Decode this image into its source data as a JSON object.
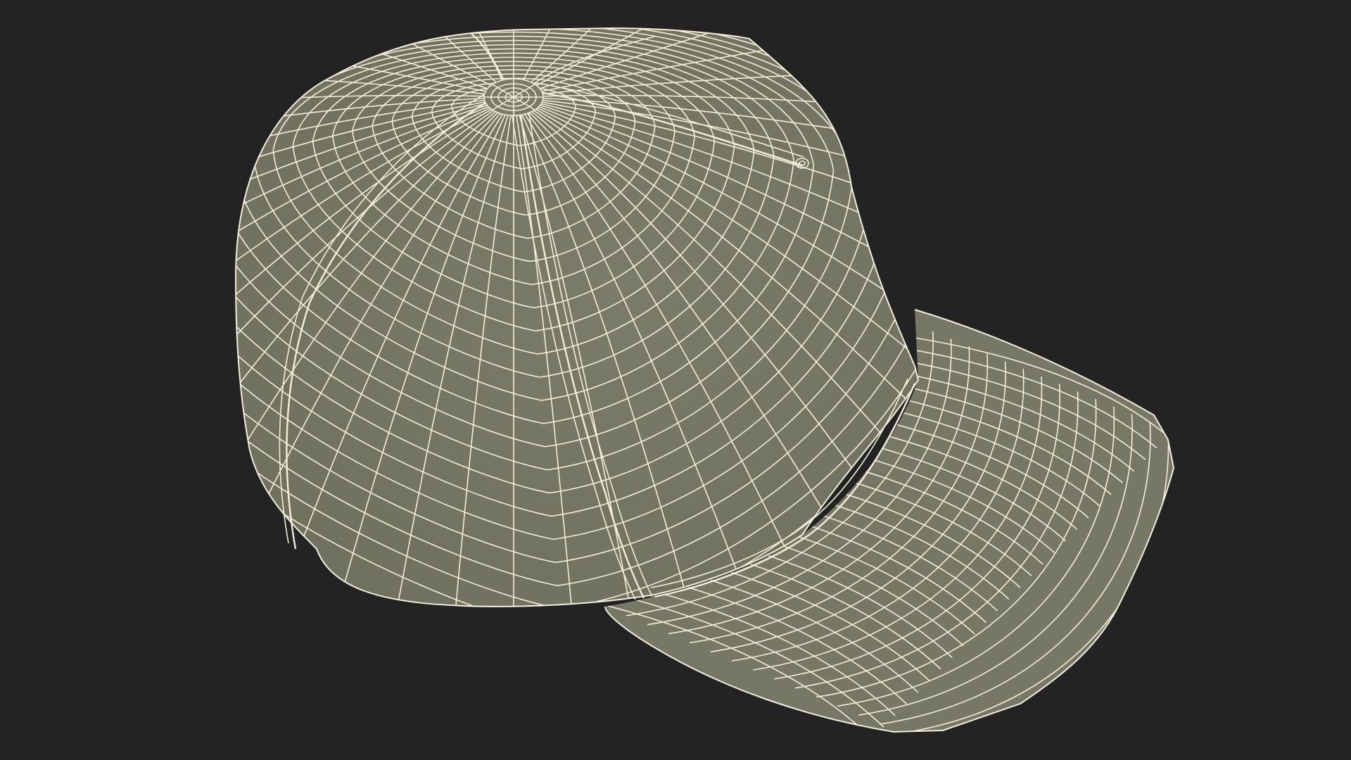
{
  "scene": {
    "subject": "baseball-cap-wireframe",
    "render_mode": "wireframe-over-shaded",
    "colors": {
      "background": "#232323",
      "surface": "#7a7a68",
      "surface_shadow": "#6a6a58",
      "wire": "#f2eedb"
    }
  }
}
